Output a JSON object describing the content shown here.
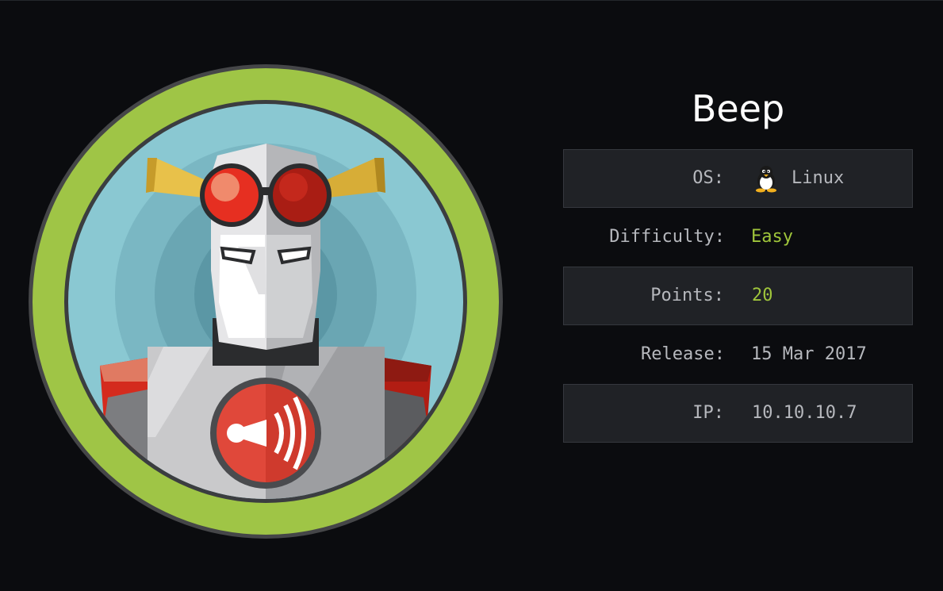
{
  "machine": {
    "name": "Beep",
    "avatar_icon": "beep-robot-avatar"
  },
  "info": {
    "os_label": "OS:",
    "os_value": "Linux",
    "os_icon": "linux-penguin-icon",
    "difficulty_label": "Difficulty:",
    "difficulty_value": "Easy",
    "points_label": "Points:",
    "points_value": "20",
    "release_label": "Release:",
    "release_value": "15 Mar 2017",
    "ip_label": "IP:",
    "ip_value": "10.10.10.7"
  },
  "colors": {
    "background": "#0b0c0f",
    "accent": "#9fc53b",
    "row_shade": "#202226",
    "text": "#b6b8bd"
  }
}
